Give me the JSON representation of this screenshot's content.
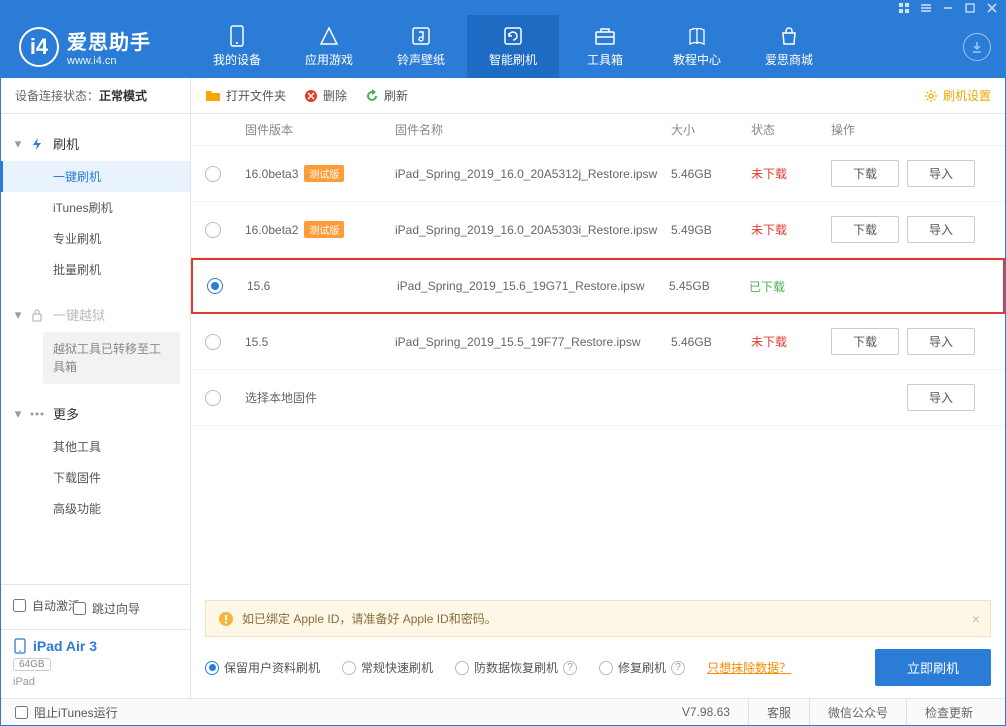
{
  "app": {
    "title": "爱思助手",
    "sub": "www.i4.cn"
  },
  "nav": {
    "items": [
      {
        "label": "我的设备"
      },
      {
        "label": "应用游戏"
      },
      {
        "label": "铃声壁纸"
      },
      {
        "label": "智能刷机"
      },
      {
        "label": "工具箱"
      },
      {
        "label": "教程中心"
      },
      {
        "label": "爱思商城"
      }
    ]
  },
  "status": {
    "label": "设备连接状态：",
    "value": "正常模式"
  },
  "sidebar": {
    "flash": {
      "title": "刷机",
      "items": [
        "一键刷机",
        "iTunes刷机",
        "专业刷机",
        "批量刷机"
      ]
    },
    "jailbreak": {
      "title": "一键越狱",
      "note": "越狱工具已转移至工具箱"
    },
    "more": {
      "title": "更多",
      "items": [
        "其他工具",
        "下载固件",
        "高级功能"
      ]
    },
    "auto_activate": "自动激活",
    "skip_guide": "跳过向导"
  },
  "device": {
    "name": "iPad Air 3",
    "capacity": "64GB",
    "type": "iPad"
  },
  "toolbar": {
    "open_folder": "打开文件夹",
    "delete": "删除",
    "refresh": "刷新",
    "settings": "刷机设置"
  },
  "table": {
    "headers": {
      "version": "固件版本",
      "name": "固件名称",
      "size": "大小",
      "status": "状态",
      "ops": "操作"
    },
    "download": "下载",
    "import": "导入",
    "beta_tag": "测试版",
    "local": "选择本地固件",
    "rows": [
      {
        "ver": "16.0beta3",
        "beta": true,
        "name": "iPad_Spring_2019_16.0_20A5312j_Restore.ipsw",
        "size": "5.46GB",
        "status": "未下载",
        "downloaded": false,
        "selected": false,
        "ops": true
      },
      {
        "ver": "16.0beta2",
        "beta": true,
        "name": "iPad_Spring_2019_16.0_20A5303i_Restore.ipsw",
        "size": "5.49GB",
        "status": "未下载",
        "downloaded": false,
        "selected": false,
        "ops": true
      },
      {
        "ver": "15.6",
        "beta": false,
        "name": "iPad_Spring_2019_15.6_19G71_Restore.ipsw",
        "size": "5.45GB",
        "status": "已下载",
        "downloaded": true,
        "selected": true,
        "ops": false,
        "highlight": true
      },
      {
        "ver": "15.5",
        "beta": false,
        "name": "iPad_Spring_2019_15.5_19F77_Restore.ipsw",
        "size": "5.46GB",
        "status": "未下载",
        "downloaded": false,
        "selected": false,
        "ops": true
      }
    ]
  },
  "notice": "如已绑定 Apple ID，请准备好 Apple ID和密码。",
  "options": {
    "items": [
      "保留用户资料刷机",
      "常规快速刷机",
      "防数据恢复刷机",
      "修复刷机"
    ],
    "erase_link": "只想抹除数据？",
    "flash_now": "立即刷机"
  },
  "footer": {
    "block_itunes": "阻止iTunes运行",
    "version": "V7.98.63",
    "service": "客服",
    "wechat": "微信公众号",
    "update": "检查更新"
  }
}
